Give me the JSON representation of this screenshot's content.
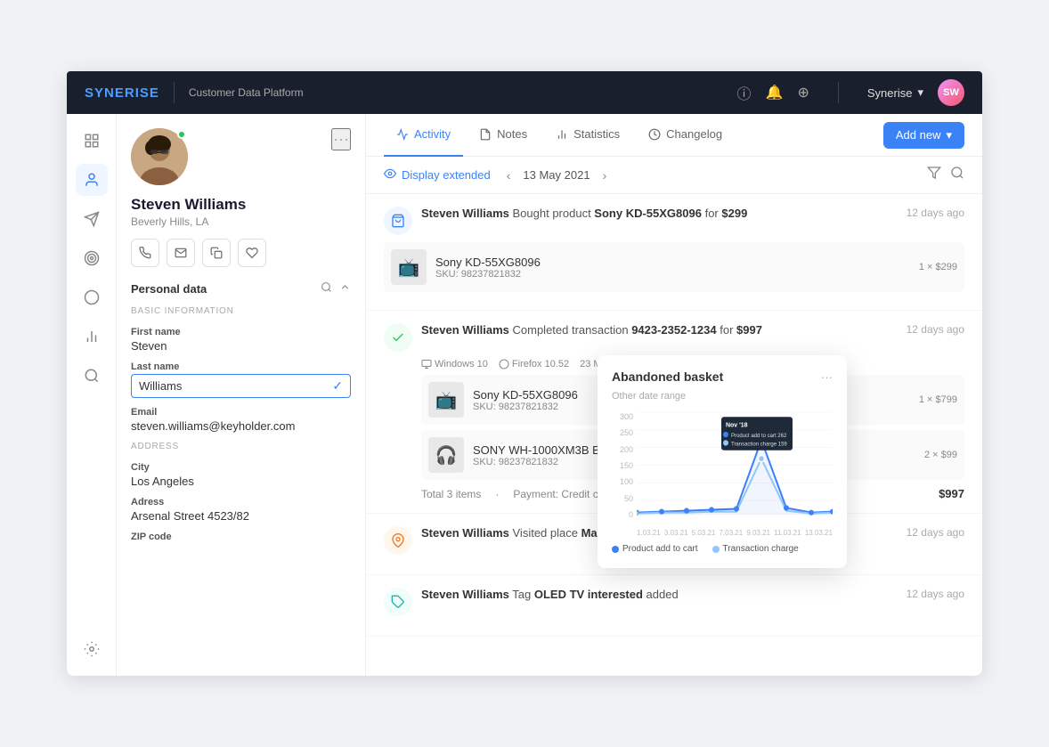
{
  "navbar": {
    "logo": "SYNERISE",
    "subtitle": "Customer Data Platform",
    "user": "Synerise",
    "icons": [
      "info-circle",
      "bell",
      "compass"
    ]
  },
  "sidebar": {
    "items": [
      {
        "id": "layout",
        "icon": "⊞",
        "active": false
      },
      {
        "id": "people",
        "icon": "👤",
        "active": true
      },
      {
        "id": "megaphone",
        "icon": "📢",
        "active": false
      },
      {
        "id": "target",
        "icon": "◎",
        "active": false
      },
      {
        "id": "circle",
        "icon": "○",
        "active": false
      },
      {
        "id": "chart",
        "icon": "📊",
        "active": false
      },
      {
        "id": "search",
        "icon": "🔍",
        "active": false
      }
    ],
    "bottom_items": [
      {
        "id": "settings",
        "icon": "⚙"
      }
    ]
  },
  "profile": {
    "name": "Steven Williams",
    "location": "Beverly Hills, LA",
    "online": true,
    "actions": [
      "phone",
      "email",
      "copy",
      "heart"
    ],
    "sections": {
      "personal_data": {
        "title": "Personal data",
        "basic_info_header": "BASIC INFORMATION",
        "fields": [
          {
            "label": "First name",
            "value": "Steven",
            "editing": false
          },
          {
            "label": "Last name",
            "value": "Williams",
            "editing": true
          },
          {
            "label": "Email",
            "value": "steven.williams@keyholder.com",
            "editing": false
          }
        ],
        "address_header": "ADDRESS",
        "address_fields": [
          {
            "label": "City",
            "value": "Los Angeles"
          },
          {
            "label": "Adress",
            "value": "Arsenal Street 4523/82"
          },
          {
            "label": "ZIP code",
            "value": ""
          }
        ]
      }
    }
  },
  "tabs": [
    {
      "id": "activity",
      "label": "Activity",
      "icon": "⚡",
      "active": true
    },
    {
      "id": "notes",
      "label": "Notes",
      "icon": "📋",
      "active": false
    },
    {
      "id": "statistics",
      "label": "Statistics",
      "icon": "📊",
      "active": false
    },
    {
      "id": "changelog",
      "label": "Changelog",
      "icon": "🕐",
      "active": false
    }
  ],
  "add_new_btn": "Add new",
  "activity_toolbar": {
    "display_extended": "Display extended",
    "date": "13 May 2021",
    "filter_icon": "filter",
    "search_icon": "search"
  },
  "activity_items": [
    {
      "id": "basket",
      "type": "basket",
      "icon_type": "blue",
      "user": "Steven Williams",
      "description": "Bought product Sony KD-55XG8096 for $299",
      "time": "12 days ago",
      "products": [
        {
          "name": "Sony KD-55XG8096",
          "sku": "SKU: 98237821832",
          "type": "tv",
          "price": "1 × $299"
        }
      ]
    },
    {
      "id": "transaction",
      "type": "transaction",
      "icon_type": "green",
      "user": "Steven Williams",
      "description": "Completed transaction 9423-2352-1234 for $997",
      "time": "12 days ago",
      "products": [
        {
          "name": "Sony KD-55XG8096",
          "sku": "SKU: 98237821832",
          "type": "tv",
          "price": "1 × $799"
        },
        {
          "name": "SONY WH-1000XM3B Black",
          "sku": "SKU: 98237821832",
          "type": "headphone",
          "price": "2 × $99"
        }
      ],
      "meta": {
        "items": "Total 3 items",
        "payment": "Payment: Credit card",
        "os": "Windows 10",
        "browser": "Firefox 10.52",
        "date": "23 May 2021, 14:30"
      },
      "total": "$997"
    },
    {
      "id": "visit",
      "type": "visit",
      "icon_type": "orange",
      "user": "Steven Williams",
      "description": "Visited place Madison Ave 940, LA with id 1423492",
      "time": "12 days ago"
    },
    {
      "id": "tag",
      "type": "tag",
      "icon_type": "teal",
      "user": "Steven Williams",
      "description": "Tag OLED TV interested added",
      "time": "12 days ago"
    }
  ],
  "abandoned_basket_popup": {
    "title": "Abandoned basket",
    "subtitle": "Other date range",
    "tooltip": {
      "date": "Nov '18",
      "items": [
        {
          "label": "Product add to cart",
          "value": "262",
          "color": "#3b82f6"
        },
        {
          "label": "Transaction charge",
          "value": "159",
          "color": "#93c5fd"
        }
      ]
    },
    "chart": {
      "y_labels": [
        "300",
        "250",
        "200",
        "150",
        "100",
        "50",
        "0"
      ],
      "x_labels": [
        "1.03.21",
        "3.03.21",
        "5.03.21",
        "7.03.21",
        "9.03.21",
        "11.03.21",
        "13.03.21"
      ],
      "legend": [
        {
          "label": "Product add to cart",
          "color": "blue"
        },
        {
          "label": "Transaction charge",
          "color": "light-blue"
        }
      ]
    }
  }
}
